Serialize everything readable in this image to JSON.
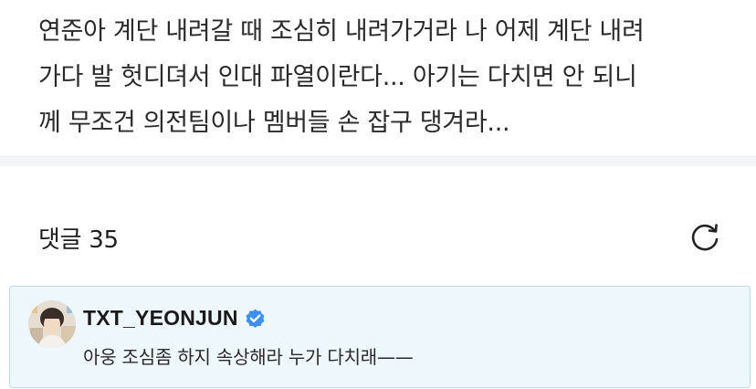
{
  "post": {
    "lines": [
      "연준아 계단 내려갈 때 조심히 내려가거라 나 어제 계단 내려",
      "가다 발 헛디뎌서 인대 파열이란다... 아기는 다치면 안 되니",
      "께 무조건 의전팀이나 멤버들 손 잡구 댕겨라..."
    ]
  },
  "comments": {
    "count_label": "댓글 35",
    "refresh_icon": "refresh-icon"
  },
  "comment": {
    "author": "TXT_YEONJUN",
    "verified_icon": "verified-badge-icon",
    "verified_color": "#3d8ef5",
    "text": "아웅 조심좀 하지 속상해라 누가 다치래——"
  },
  "colors": {
    "card_bg": "#eef7fc",
    "card_border": "#b9dcf0",
    "divider": "#f3f4f6"
  }
}
